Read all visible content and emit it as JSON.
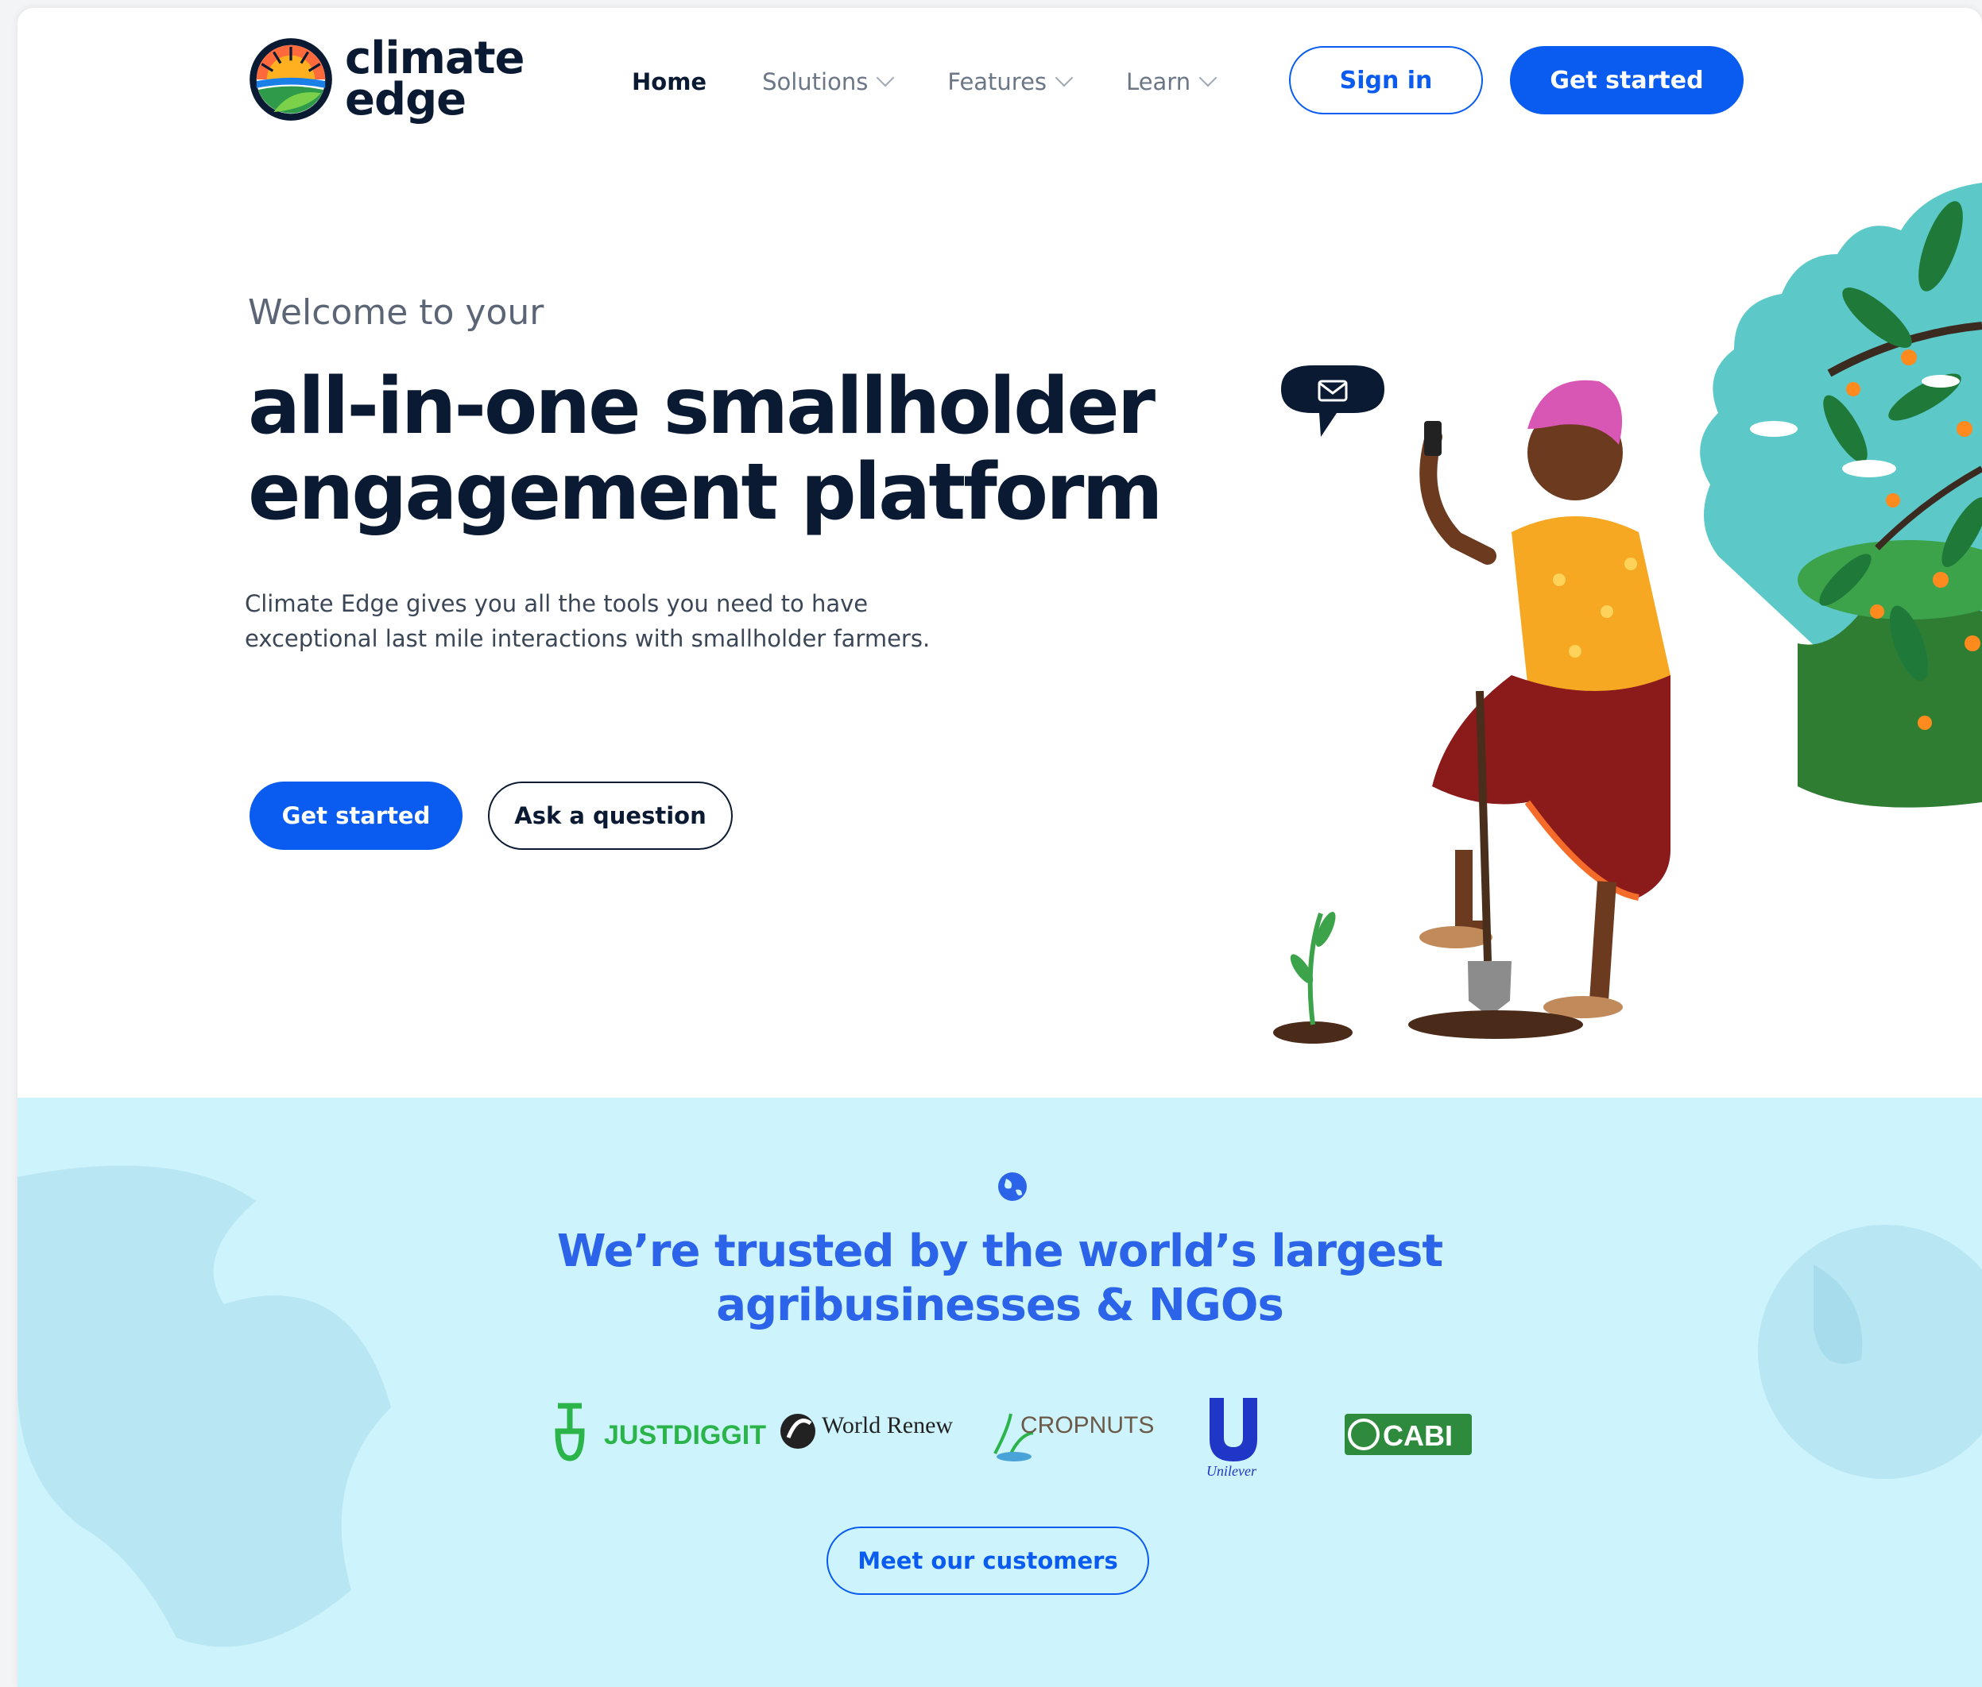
{
  "brand": {
    "name_line1": "climate",
    "name_line2": "edge"
  },
  "nav": {
    "items": [
      {
        "label": "Home",
        "has_dropdown": false,
        "active": true
      },
      {
        "label": "Solutions",
        "has_dropdown": true,
        "active": false
      },
      {
        "label": "Features",
        "has_dropdown": true,
        "active": false
      },
      {
        "label": "Learn",
        "has_dropdown": true,
        "active": false
      }
    ],
    "sign_in": "Sign in",
    "get_started": "Get started"
  },
  "hero": {
    "eyebrow": "Welcome to your",
    "headline_line1": "all-in-one smallholder",
    "headline_line2": "engagement platform",
    "subtext_line1": "Climate Edge gives you all the tools you need to have",
    "subtext_line2": "exceptional last mile interactions with smallholder farmers.",
    "primary_cta": "Get started",
    "secondary_cta": "Ask a question",
    "illustration_icon": "farmer-with-phone-illustration"
  },
  "trusted": {
    "icon": "globe-icon",
    "title_line1": "We’re trusted by the world’s largest",
    "title_line2": "agribusinesses & NGOs",
    "logos": [
      "JUSTDIGGIT",
      "World Renew",
      "CROPNUTS",
      "Unilever",
      "CABI"
    ],
    "cta": "Meet our customers"
  },
  "colors": {
    "primary": "#0a5cf0",
    "navy": "#0b1a33",
    "trusted_bg": "#cdf3fc",
    "trusted_title": "#2b64e8"
  }
}
